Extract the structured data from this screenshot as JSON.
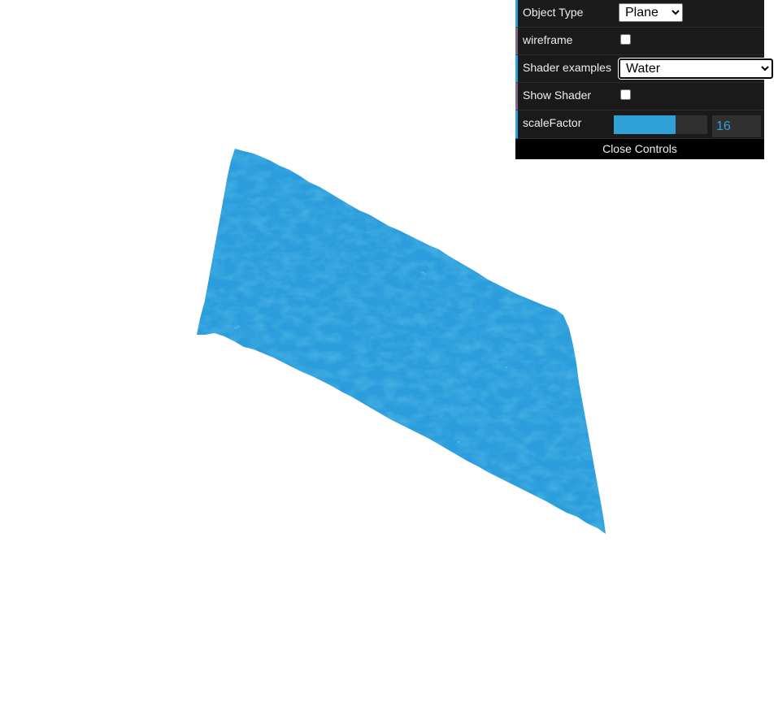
{
  "gui": {
    "object_type": {
      "label": "Object Type",
      "selected": "Plane"
    },
    "wireframe": {
      "label": "wireframe",
      "checked": false
    },
    "shader_examples": {
      "label": "Shader examples",
      "selected": "Water"
    },
    "show_shader": {
      "label": "Show Shader",
      "checked": false
    },
    "scale_factor": {
      "label": "scaleFactor",
      "value": "16",
      "fill_fraction": 0.66
    },
    "close_label": "Close Controls"
  },
  "scene": {
    "object": "water-textured-plane",
    "base_color": "#2f9fdf",
    "highlight_color": "#5fd0ef",
    "shadow_color": "#1d7fc0"
  },
  "colors": {
    "accent": "#2fa1d6",
    "panel_bg": "#1a1a1a",
    "bool_accent": "#806787"
  }
}
